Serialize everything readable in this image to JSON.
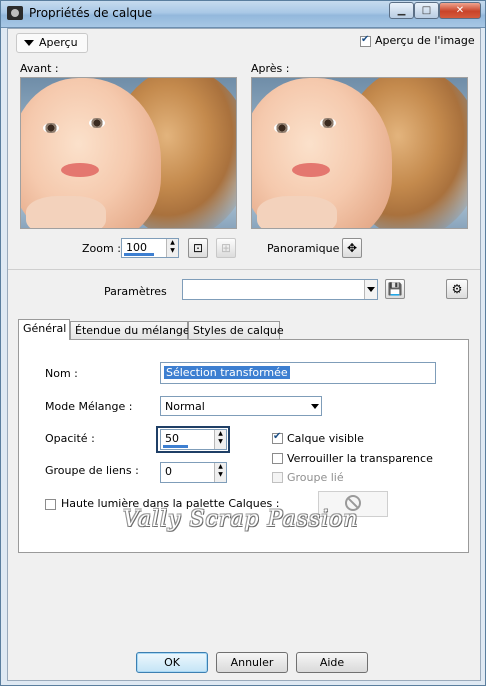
{
  "window": {
    "title": "Propriétés de calque",
    "controls": {
      "minimize": "▁",
      "maximize": "□",
      "close": "✕"
    }
  },
  "preview": {
    "toggle_label": "Aperçu",
    "show_image_label": "Aperçu de l'image",
    "show_image_checked": true,
    "before_label": "Avant :",
    "after_label": "Après :",
    "zoom_label": "Zoom :",
    "zoom_value": "100",
    "pan_label": "Panoramique :"
  },
  "presets": {
    "label": "Paramètres",
    "value": ""
  },
  "tabs": [
    {
      "label": "Général",
      "active": true
    },
    {
      "label": "Étendue du mélange",
      "active": false
    },
    {
      "label": "Styles de calque",
      "active": false
    }
  ],
  "general": {
    "name_label": "Nom :",
    "name_value": "Sélection transformée",
    "blend_label": "Mode Mélange :",
    "blend_value": "Normal",
    "opacity_label": "Opacité :",
    "opacity_value": "50",
    "opacity_percent": 50,
    "link_group_label": "Groupe de liens :",
    "link_group_value": "0",
    "visible_label": "Calque visible",
    "visible_checked": true,
    "lock_transparency_label": "Verrouiller la transparence",
    "lock_transparency_checked": false,
    "group_linked_label": "Groupe lié",
    "group_linked_checked": false,
    "highlight_label": "Haute lumière dans la palette Calques :",
    "highlight_checked": false
  },
  "watermark": "Vally Scrap Passion",
  "buttons": {
    "ok": "OK",
    "cancel": "Annuler",
    "help": "Aide"
  },
  "colors": {
    "accent": "#3d7fd1",
    "title_bar": "#a9c8e6",
    "close": "#c9442a"
  },
  "icons": [
    "camera-icon",
    "chevron-down-icon",
    "fit-zoom-icon",
    "actual-size-icon",
    "pan-icon",
    "save-preset-icon",
    "preset-manager-icon",
    "no-sign-icon"
  ]
}
